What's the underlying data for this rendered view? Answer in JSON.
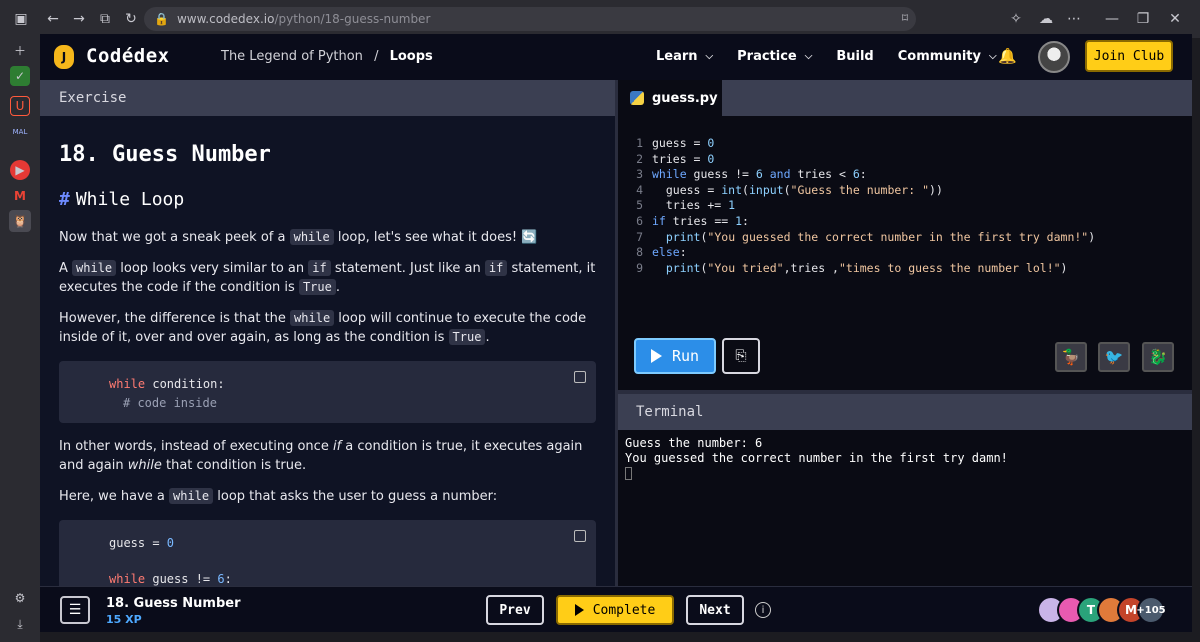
{
  "browser": {
    "url_host": "www.codedex.io",
    "url_path": "/python/18-guess-number"
  },
  "nav": {
    "brand": "Codédex",
    "logo_letter": "J",
    "course": "The Legend of Python",
    "section": "Loops",
    "links": [
      "Learn",
      "Practice",
      "Build",
      "Community"
    ],
    "join_label": "Join Club"
  },
  "exercise": {
    "header": "Exercise",
    "title": "18. Guess Number",
    "subtitle": "While Loop",
    "p1_a": "Now that we got a sneak peek of a ",
    "p1_code": "while",
    "p1_b": " loop, let's see what it does! 🔄",
    "p2_a": "A ",
    "p2_code1": "while",
    "p2_b": " loop looks very similar to an ",
    "p2_code2": "if",
    "p2_c": " statement. Just like an ",
    "p2_code3": "if",
    "p2_d": " statement, it executes the code if the condition is ",
    "p2_code4": "True",
    "p2_e": ".",
    "p3_a": "However, the difference is that the ",
    "p3_code1": "while",
    "p3_b": " loop will continue to execute the code inside of it, over and over again, as long as the condition is ",
    "p3_code2": "True",
    "p3_c": ".",
    "code1_kw": "while",
    "code1_rest": " condition:",
    "code1_comment": "# code inside",
    "p4_a": "In other words, instead of executing once ",
    "p4_i1": "if",
    "p4_b": " a condition is true, it executes again and again ",
    "p4_i2": "while",
    "p4_c": " that condition is true.",
    "p5_a": "Here, we have a ",
    "p5_code": "while",
    "p5_b": " loop that asks the user to guess a number:",
    "code2_line1_a": "guess = ",
    "code2_line1_num": "0",
    "code2_line2_kw": "while",
    "code2_line2_rest": " guess != ",
    "code2_line2_num": "6",
    "code2_line2_end": ":"
  },
  "editor": {
    "filename": "guess.py",
    "lines": [
      {
        "n": "1",
        "parts": [
          [
            "t",
            "guess = "
          ],
          [
            "num2",
            "0"
          ]
        ]
      },
      {
        "n": "2",
        "parts": [
          [
            "t",
            "tries = "
          ],
          [
            "num2",
            "0"
          ]
        ]
      },
      {
        "n": "3",
        "parts": [
          [
            "kw2",
            "while"
          ],
          [
            "t",
            " guess != "
          ],
          [
            "num2",
            "6"
          ],
          [
            "t",
            " "
          ],
          [
            "kw2",
            "and"
          ],
          [
            "t",
            " tries < "
          ],
          [
            "num2",
            "6"
          ],
          [
            "t",
            ":"
          ]
        ]
      },
      {
        "n": "4",
        "parts": [
          [
            "t",
            "  guess = "
          ],
          [
            "fn",
            "int"
          ],
          [
            "t",
            "("
          ],
          [
            "fn",
            "input"
          ],
          [
            "t",
            "("
          ],
          [
            "str",
            "\"Guess the number: \""
          ],
          [
            "t",
            "))"
          ]
        ]
      },
      {
        "n": "5",
        "parts": [
          [
            "t",
            "  tries += "
          ],
          [
            "num2",
            "1"
          ]
        ]
      },
      {
        "n": "6",
        "parts": [
          [
            "kw2",
            "if"
          ],
          [
            "t",
            " tries == "
          ],
          [
            "num2",
            "1"
          ],
          [
            "t",
            ":"
          ]
        ]
      },
      {
        "n": "7",
        "parts": [
          [
            "t",
            "  "
          ],
          [
            "fn",
            "print"
          ],
          [
            "t",
            "("
          ],
          [
            "str",
            "\"You guessed the correct number in the first try damn!\""
          ],
          [
            "t",
            ")"
          ]
        ]
      },
      {
        "n": "8",
        "parts": [
          [
            "kw2",
            "else"
          ],
          [
            "t",
            ":"
          ]
        ]
      },
      {
        "n": "9",
        "parts": [
          [
            "t",
            "  "
          ],
          [
            "fn",
            "print"
          ],
          [
            "t",
            "("
          ],
          [
            "str",
            "\"You tried\""
          ],
          [
            "t",
            ",tries ,"
          ],
          [
            "str",
            "\"times to guess the number lol!\""
          ],
          [
            "t",
            ")"
          ]
        ]
      }
    ],
    "run_label": "Run"
  },
  "terminal": {
    "header": "Terminal",
    "line1": "Guess the number: 6",
    "line2": "You guessed the correct number in the first try damn!"
  },
  "footer": {
    "title": "18. Guess Number",
    "xp": "15 XP",
    "prev": "Prev",
    "complete": "Complete",
    "next": "Next",
    "more_count": "+105",
    "avatars": [
      {
        "letter": "",
        "color": "#c9b4e8"
      },
      {
        "letter": "",
        "color": "#e85ab0"
      },
      {
        "letter": "T",
        "color": "#2aa37a"
      },
      {
        "letter": "",
        "color": "#e07a3a"
      },
      {
        "letter": "M",
        "color": "#c4442a"
      }
    ]
  }
}
